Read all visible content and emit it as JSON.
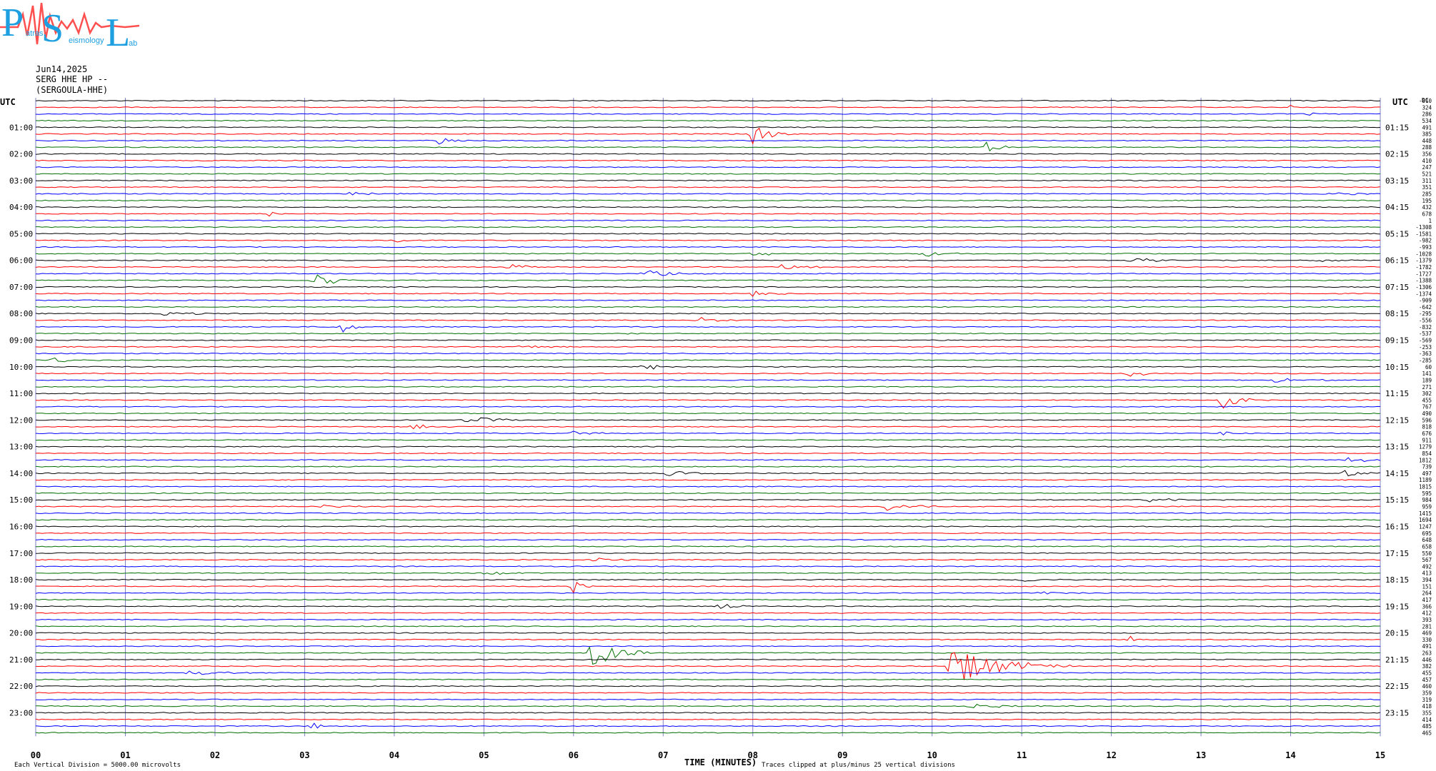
{
  "logo": {
    "letters": "PSL",
    "words": [
      "atras",
      "eismology",
      "ab"
    ]
  },
  "header": {
    "date": "Jun14,2025",
    "station": "SERG HHE HP --",
    "location": "(SERGOULA-HHE)"
  },
  "axis": {
    "left_title": "UTC",
    "right_title": "UTC",
    "dc_title": "DC",
    "xlabel": "TIME (MINUTES)",
    "xticks": [
      "00",
      "01",
      "02",
      "03",
      "04",
      "05",
      "06",
      "07",
      "08",
      "09",
      "10",
      "11",
      "12",
      "13",
      "14",
      "15"
    ],
    "left_labels": [
      "01:00",
      "02:00",
      "03:00",
      "04:00",
      "05:00",
      "06:00",
      "07:00",
      "08:00",
      "09:00",
      "10:00",
      "11:00",
      "12:00",
      "13:00",
      "14:00",
      "15:00",
      "16:00",
      "17:00",
      "18:00",
      "19:00",
      "20:00",
      "21:00",
      "22:00",
      "23:00"
    ],
    "right_labels": [
      "01:15",
      "02:15",
      "03:15",
      "04:15",
      "05:15",
      "06:15",
      "07:15",
      "08:15",
      "09:15",
      "10:15",
      "11:15",
      "12:15",
      "13:15",
      "14:15",
      "15:15",
      "16:15",
      "17:15",
      "18:15",
      "19:15",
      "20:15",
      "21:15",
      "22:15",
      "23:15"
    ]
  },
  "footer": {
    "left": "Each Vertical Division = 5000.00 microvolts",
    "mid": "Traces clipped at plus/minus 25 vertical divisions"
  },
  "chart_data": {
    "type": "line",
    "x_range_minutes": [
      0,
      15
    ],
    "trace_minutes": 15,
    "trace_count": 96,
    "trace_colors": [
      "#000000",
      "#ff0000",
      "#0000ff",
      "#007000"
    ],
    "grid_color": "#8080c0",
    "dc_offsets": [
      "-810",
      "324",
      "286",
      "534",
      "491",
      "385",
      "448",
      "288",
      "356",
      "410",
      "247",
      "521",
      "311",
      "351",
      "285",
      "195",
      "432",
      "678",
      "1",
      "-1308",
      "-1581",
      "-982",
      "-993",
      "-1028",
      "-1379",
      "-1782",
      "-1727",
      "-1388",
      "-1306",
      "-1374",
      "-909",
      "-642",
      "-295",
      "-556",
      "-832",
      "-537",
      "-569",
      "-253",
      "-363",
      "-285",
      "60",
      "141",
      "189",
      "271",
      "302",
      "455",
      "767",
      "490",
      "596",
      "818",
      "676",
      "911",
      "1279",
      "854",
      "1812",
      "739",
      "497",
      "1189",
      "1815",
      "595",
      "984",
      "959",
      "1415",
      "1694",
      "1247",
      "695",
      "648",
      "658",
      "550",
      "567",
      "492",
      "413",
      "394",
      "151",
      "264",
      "417",
      "366",
      "412",
      "393",
      "281",
      "469",
      "330",
      "491",
      "263",
      "446",
      "382",
      "455",
      "457",
      "460",
      "359",
      "319",
      "418",
      "355",
      "414",
      "485",
      "465"
    ],
    "events": [
      {
        "trace": 1,
        "minute": 14.0,
        "amp": 0.7,
        "dur": 0.08
      },
      {
        "trace": 2,
        "minute": 14.2,
        "amp": 0.3,
        "dur": 0.4
      },
      {
        "trace": 5,
        "minute": 8.0,
        "amp": 1.6,
        "dur": 0.5
      },
      {
        "trace": 6,
        "minute": 4.5,
        "amp": 0.6,
        "dur": 0.3
      },
      {
        "trace": 7,
        "minute": 10.6,
        "amp": 0.9,
        "dur": 0.4
      },
      {
        "trace": 14,
        "minute": 3.5,
        "amp": 0.3,
        "dur": 1.2
      },
      {
        "trace": 14,
        "minute": 14.4,
        "amp": 0.5,
        "dur": 0.7
      },
      {
        "trace": 17,
        "minute": 2.6,
        "amp": 0.4,
        "dur": 0.4
      },
      {
        "trace": 21,
        "minute": 4.0,
        "amp": 0.3,
        "dur": 0.6
      },
      {
        "trace": 23,
        "minute": 8.0,
        "amp": 0.5,
        "dur": 0.6
      },
      {
        "trace": 23,
        "minute": 9.9,
        "amp": 0.5,
        "dur": 0.6
      },
      {
        "trace": 24,
        "minute": 12.2,
        "amp": 0.6,
        "dur": 0.8
      },
      {
        "trace": 24,
        "minute": 14.3,
        "amp": 0.4,
        "dur": 0.5
      },
      {
        "trace": 25,
        "minute": 5.3,
        "amp": 0.6,
        "dur": 0.6
      },
      {
        "trace": 25,
        "minute": 8.3,
        "amp": 0.4,
        "dur": 0.8
      },
      {
        "trace": 26,
        "minute": 6.8,
        "amp": 0.6,
        "dur": 1.0
      },
      {
        "trace": 27,
        "minute": 3.1,
        "amp": 1.8,
        "dur": 0.5
      },
      {
        "trace": 29,
        "minute": 8.0,
        "amp": 0.6,
        "dur": 0.6
      },
      {
        "trace": 32,
        "minute": 1.4,
        "amp": 0.3,
        "dur": 1.0
      },
      {
        "trace": 33,
        "minute": 7.4,
        "amp": 0.5,
        "dur": 0.6
      },
      {
        "trace": 34,
        "minute": 3.4,
        "amp": 1.2,
        "dur": 0.3
      },
      {
        "trace": 35,
        "minute": 6.6,
        "amp": 0.3,
        "dur": 0.5
      },
      {
        "trace": 37,
        "minute": 5.3,
        "amp": 0.4,
        "dur": 0.8
      },
      {
        "trace": 39,
        "minute": 0.2,
        "amp": 0.5,
        "dur": 0.6
      },
      {
        "trace": 40,
        "minute": 6.8,
        "amp": 0.6,
        "dur": 0.4
      },
      {
        "trace": 41,
        "minute": 12.2,
        "amp": 0.5,
        "dur": 0.6
      },
      {
        "trace": 42,
        "minute": 13.8,
        "amp": 0.4,
        "dur": 1.0
      },
      {
        "trace": 45,
        "minute": 13.2,
        "amp": 1.6,
        "dur": 0.6
      },
      {
        "trace": 48,
        "minute": 4.8,
        "amp": 0.6,
        "dur": 0.9
      },
      {
        "trace": 49,
        "minute": 4.2,
        "amp": 0.5,
        "dur": 0.5
      },
      {
        "trace": 50,
        "minute": 6.0,
        "amp": 0.5,
        "dur": 0.5
      },
      {
        "trace": 50,
        "minute": 13.2,
        "amp": 0.5,
        "dur": 0.5
      },
      {
        "trace": 54,
        "minute": 14.6,
        "amp": 0.5,
        "dur": 0.8
      },
      {
        "trace": 56,
        "minute": 7.0,
        "amp": 0.4,
        "dur": 1.0
      },
      {
        "trace": 56,
        "minute": 14.6,
        "amp": 0.5,
        "dur": 0.6
      },
      {
        "trace": 60,
        "minute": 12.4,
        "amp": 0.4,
        "dur": 1.0
      },
      {
        "trace": 61,
        "minute": 9.5,
        "amp": 0.7,
        "dur": 0.9
      },
      {
        "trace": 61,
        "minute": 3.2,
        "amp": 0.3,
        "dur": 0.6
      },
      {
        "trace": 69,
        "minute": 6.2,
        "amp": 0.3,
        "dur": 1.2
      },
      {
        "trace": 71,
        "minute": 5.0,
        "amp": 0.4,
        "dur": 0.8
      },
      {
        "trace": 72,
        "minute": 11.0,
        "amp": 0.3,
        "dur": 1.0
      },
      {
        "trace": 73,
        "minute": 6.0,
        "amp": 0.9,
        "dur": 0.3
      },
      {
        "trace": 74,
        "minute": 11.2,
        "amp": 0.3,
        "dur": 0.6
      },
      {
        "trace": 76,
        "minute": 7.6,
        "amp": 0.5,
        "dur": 0.5
      },
      {
        "trace": 81,
        "minute": 12.2,
        "amp": 0.8,
        "dur": 0.1
      },
      {
        "trace": 83,
        "minute": 6.2,
        "amp": 3.0,
        "dur": 0.7
      },
      {
        "trace": 85,
        "minute": 10.2,
        "amp": 3.2,
        "dur": 1.4
      },
      {
        "trace": 86,
        "minute": 1.7,
        "amp": 0.4,
        "dur": 1.0
      },
      {
        "trace": 91,
        "minute": 10.4,
        "amp": 0.4,
        "dur": 1.0
      },
      {
        "trace": 94,
        "minute": 3.1,
        "amp": 0.8,
        "dur": 0.2
      }
    ]
  }
}
